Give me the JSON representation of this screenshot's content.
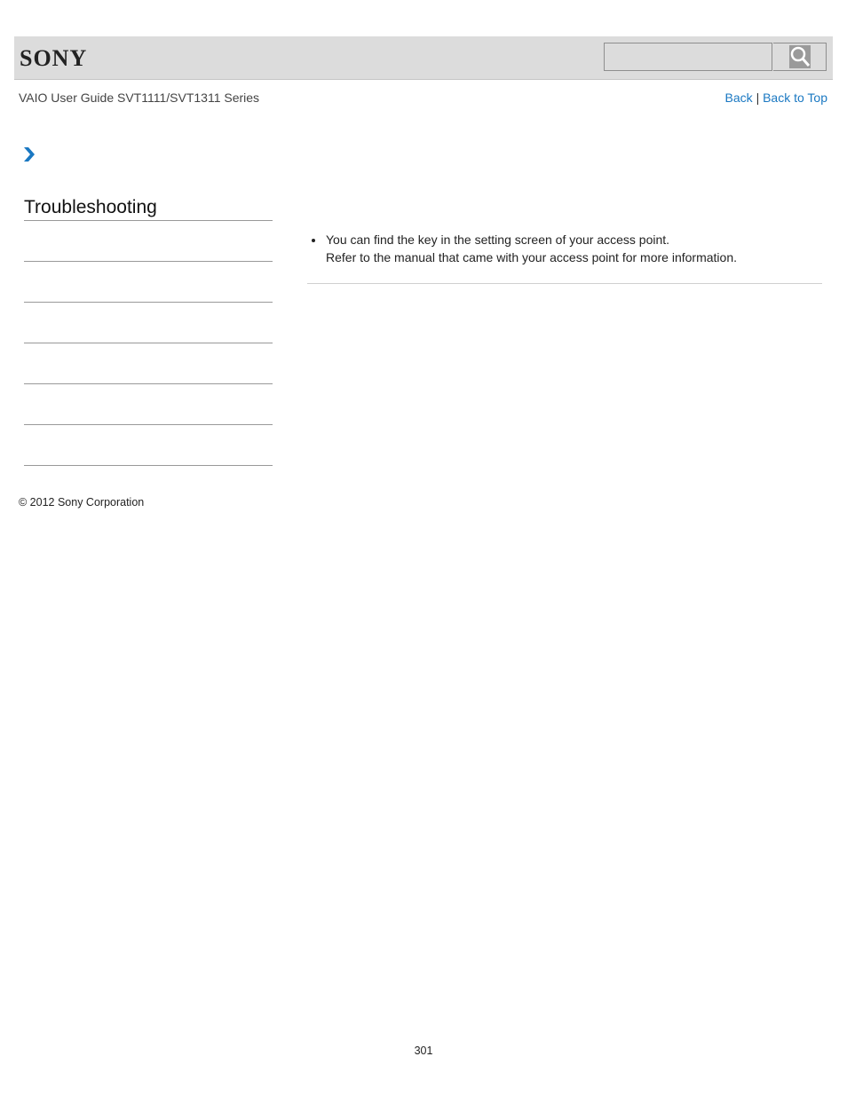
{
  "header": {
    "logo": "SONY",
    "search": {
      "placeholder": "",
      "value": "",
      "button_icon": "search-icon"
    }
  },
  "subheader": {
    "guide_title": "VAIO User Guide SVT1111/SVT1311 Series",
    "nav": {
      "back_label": "Back",
      "separator": "|",
      "back_to_top_label": "Back to Top"
    }
  },
  "breadcrumb": {
    "icon": "chevron-right-icon",
    "color": "#1a78c2"
  },
  "sidebar": {
    "title": "Troubleshooting",
    "items": [
      "",
      "",
      "",
      "",
      "",
      ""
    ]
  },
  "content": {
    "bullets": [
      {
        "line1": "You can find the key in the setting screen of your access point.",
        "line2": "Refer to the manual that came with your access point for more information."
      }
    ]
  },
  "footer": {
    "copyright": "© 2012 Sony Corporation",
    "page_number": "301"
  }
}
